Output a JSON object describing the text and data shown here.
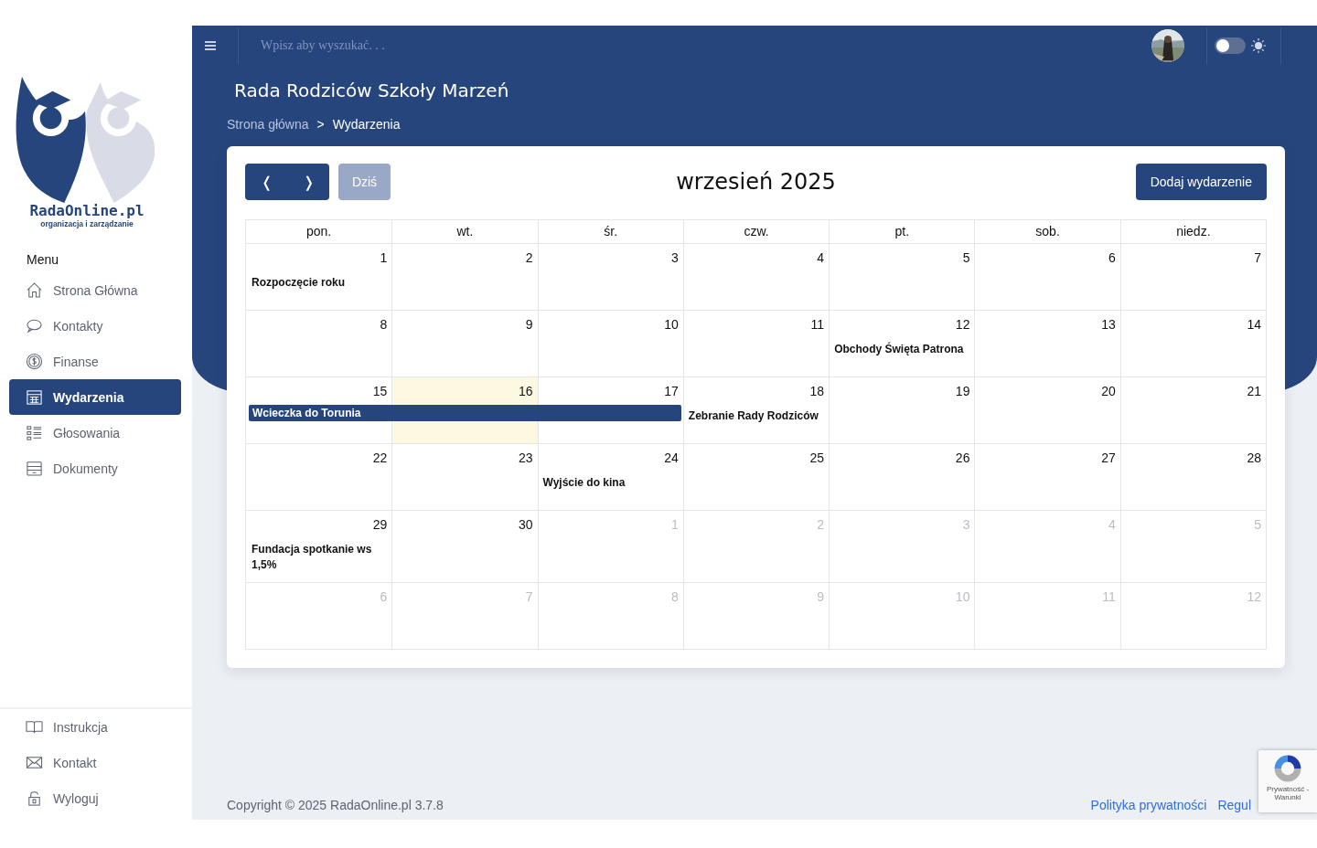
{
  "logo": {
    "name": "RadaOnline.pl",
    "tagline": "organizacja i zarządzanie"
  },
  "sidebar": {
    "heading": "Menu",
    "items": [
      {
        "label": "Strona Główna",
        "selected": false
      },
      {
        "label": "Kontakty",
        "selected": false
      },
      {
        "label": "Finanse",
        "selected": false
      },
      {
        "label": "Wydarzenia",
        "selected": true
      },
      {
        "label": "Głosowania",
        "selected": false
      },
      {
        "label": "Dokumenty",
        "selected": false
      }
    ],
    "bottom_items": [
      {
        "label": "Instrukcja"
      },
      {
        "label": "Kontakt"
      },
      {
        "label": "Wyloguj"
      }
    ]
  },
  "topbar": {
    "search": {
      "placeholder": "Wpisz aby wyszukać. . ."
    },
    "theme_toggle": {
      "on": false
    }
  },
  "page_title": "Rada Rodziców Szkoły Marzeń",
  "breadcrumb": [
    {
      "label": "Strona główna",
      "current": false
    },
    {
      "label": "Wydarzenia",
      "current": true
    }
  ],
  "breadcrumb_separator": ">",
  "calendar": {
    "prev": "❬",
    "next": "❭",
    "today_button": "Dziś",
    "today_disabled": true,
    "month": "wrzesień 2025",
    "add_button": "Dodaj wydarzenie",
    "weekdays": [
      "pon.",
      "wt.",
      "śr.",
      "czw.",
      "pt.",
      "sob.",
      "niedz."
    ],
    "weeks": [
      [
        {
          "day": "1",
          "other_month": false,
          "today": false,
          "events": [
            {
              "title": "Rozpoczęcie roku",
              "kind": "text"
            }
          ]
        },
        {
          "day": "2",
          "other_month": false,
          "today": false
        },
        {
          "day": "3",
          "other_month": false,
          "today": false
        },
        {
          "day": "4",
          "other_month": false,
          "today": false
        },
        {
          "day": "5",
          "other_month": false,
          "today": false
        },
        {
          "day": "6",
          "other_month": false,
          "today": false
        },
        {
          "day": "7",
          "other_month": false,
          "today": false
        }
      ],
      [
        {
          "day": "8",
          "other_month": false,
          "today": false
        },
        {
          "day": "9",
          "other_month": false,
          "today": false
        },
        {
          "day": "10",
          "other_month": false,
          "today": false
        },
        {
          "day": "11",
          "other_month": false,
          "today": false
        },
        {
          "day": "12",
          "other_month": false,
          "today": false,
          "events": [
            {
              "title": "Obchody Święta Patrona",
              "kind": "text"
            }
          ]
        },
        {
          "day": "13",
          "other_month": false,
          "today": false
        },
        {
          "day": "14",
          "other_month": false,
          "today": false
        }
      ],
      [
        {
          "day": "15",
          "other_month": false,
          "today": false,
          "events": [
            {
              "title": "Wcieczka do Torunia",
              "kind": "bar"
            }
          ]
        },
        {
          "day": "16",
          "other_month": false,
          "today": true,
          "event_continues": true
        },
        {
          "day": "17",
          "other_month": false,
          "today": false,
          "event_continues": true
        },
        {
          "day": "18",
          "other_month": false,
          "today": false,
          "events": [
            {
              "title": "Zebranie Rady Rodziców",
              "kind": "text"
            }
          ]
        },
        {
          "day": "19",
          "other_month": false,
          "today": false
        },
        {
          "day": "20",
          "other_month": false,
          "today": false
        },
        {
          "day": "21",
          "other_month": false,
          "today": false
        }
      ],
      [
        {
          "day": "22",
          "other_month": false,
          "today": false
        },
        {
          "day": "23",
          "other_month": false,
          "today": false
        },
        {
          "day": "24",
          "other_month": false,
          "today": false,
          "events": [
            {
              "title": "Wyjście do kina",
              "kind": "text"
            }
          ]
        },
        {
          "day": "25",
          "other_month": false,
          "today": false
        },
        {
          "day": "26",
          "other_month": false,
          "today": false
        },
        {
          "day": "27",
          "other_month": false,
          "today": false
        },
        {
          "day": "28",
          "other_month": false,
          "today": false
        }
      ],
      [
        {
          "day": "29",
          "other_month": false,
          "today": false,
          "events": [
            {
              "title": "Fundacja spotkanie ws 1,5%",
              "kind": "text"
            }
          ]
        },
        {
          "day": "30",
          "other_month": false,
          "today": false
        },
        {
          "day": "1",
          "other_month": true,
          "today": false
        },
        {
          "day": "2",
          "other_month": true,
          "today": false
        },
        {
          "day": "3",
          "other_month": true,
          "today": false
        },
        {
          "day": "4",
          "other_month": true,
          "today": false
        },
        {
          "day": "5",
          "other_month": true,
          "today": false
        }
      ],
      [
        {
          "day": "6",
          "other_month": true,
          "today": false
        },
        {
          "day": "7",
          "other_month": true,
          "today": false
        },
        {
          "day": "8",
          "other_month": true,
          "today": false
        },
        {
          "day": "9",
          "other_month": true,
          "today": false
        },
        {
          "day": "10",
          "other_month": true,
          "today": false
        },
        {
          "day": "11",
          "other_month": true,
          "today": false
        },
        {
          "day": "12",
          "other_month": true,
          "today": false
        }
      ]
    ]
  },
  "footer": {
    "copyright": "Copyright © 2025 RadaOnline.pl 3.7.8",
    "links": [
      "Polityka prywatności",
      "Regul"
    ]
  },
  "recaptcha": {
    "text": "Prywatność - Warunki"
  }
}
